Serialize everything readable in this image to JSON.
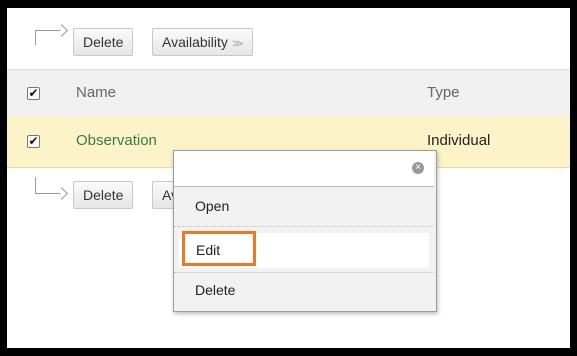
{
  "action_bar": {
    "delete_label": "Delete",
    "availability_label": "Availability",
    "availability_chevron": "≫"
  },
  "table": {
    "columns": [
      "Name",
      "Type"
    ],
    "rows": [
      {
        "name": "Observation",
        "type": "Individual",
        "checked": true
      }
    ]
  },
  "context_menu": {
    "search_value": "",
    "items": [
      "Open",
      "Edit",
      "Delete"
    ],
    "highlighted_item": "Edit",
    "highlight_color": "#f07820"
  },
  "colors": {
    "selected_row_bg": "#fdf3c8",
    "link_text": "#3a7a4a",
    "header_bg": "#f1f1f1"
  }
}
